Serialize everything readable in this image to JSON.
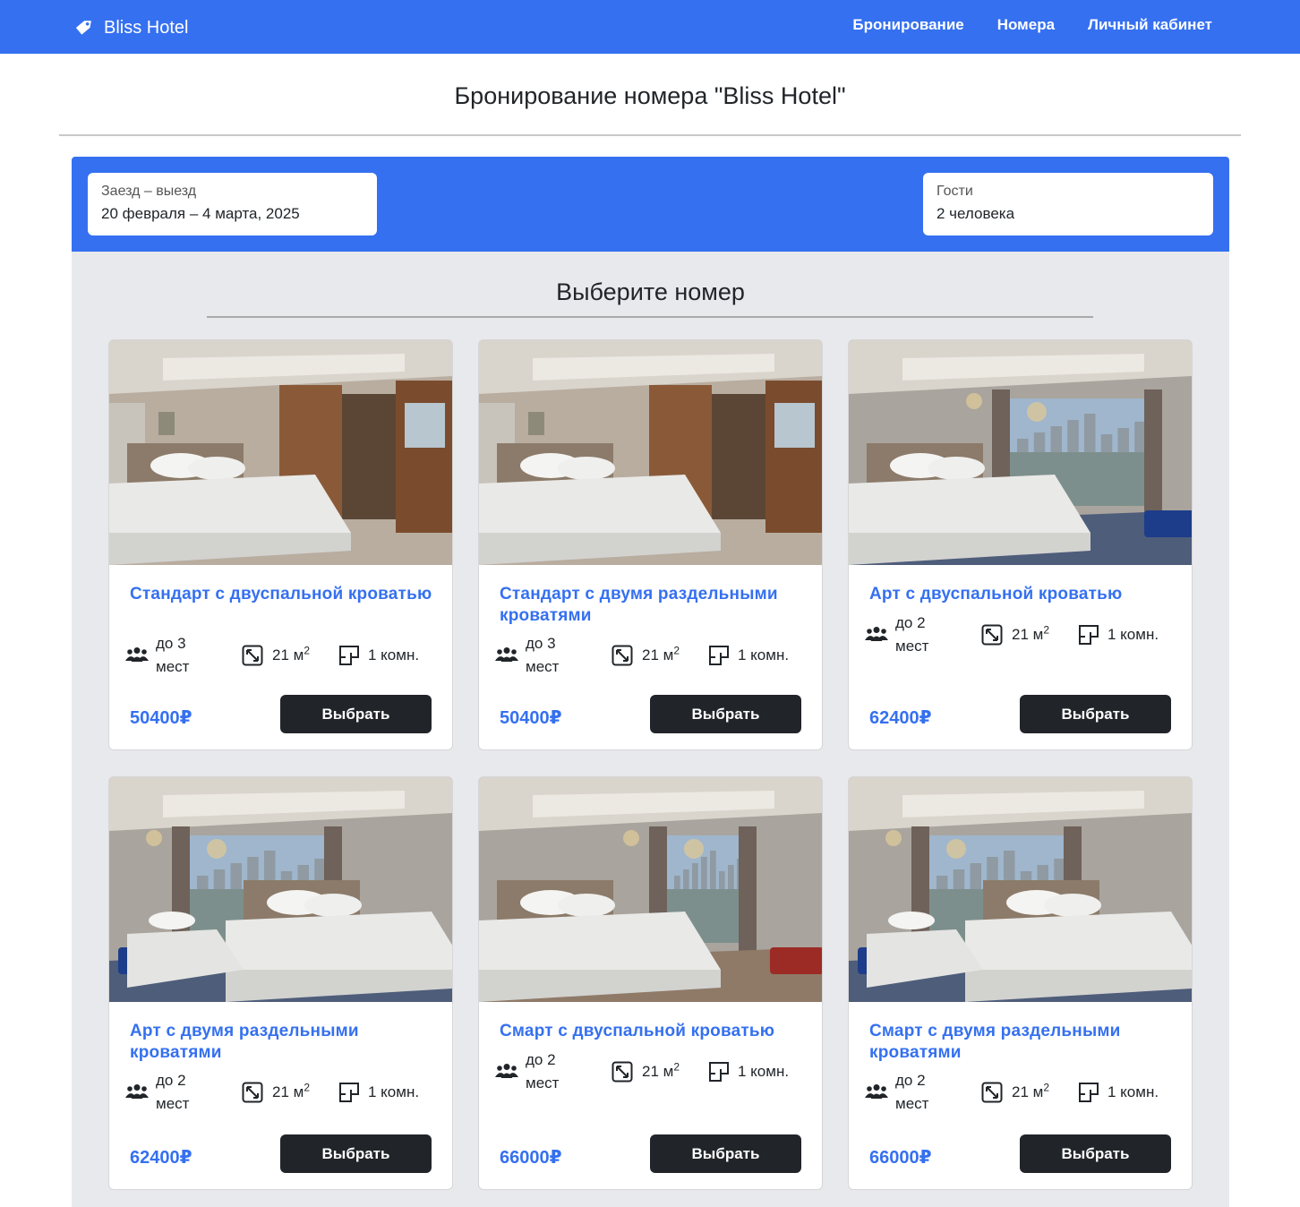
{
  "nav": {
    "brand": "Bliss Hotel",
    "links": [
      "Бронирование",
      "Номера",
      "Личный кабинет"
    ]
  },
  "page_title": "Бронирование номера \"Bliss Hotel\"",
  "search": {
    "dates_label": "Заезд – выезд",
    "dates_value": "20 февраля – 4 марта, 2025",
    "guests_label": "Гости",
    "guests_value": "2 человека"
  },
  "section_title": "Выберите номер",
  "colors": {
    "accent": "#3570f0",
    "button": "#212529",
    "panel": "#e8e9ec"
  },
  "rooms": [
    {
      "title": "Стандарт с двуспальной кроватью",
      "capacity": "до 3 мест",
      "area": "21 м",
      "area_sup": "2",
      "rooms": "1 комн.",
      "price": "50400₽",
      "button": "Выбрать"
    },
    {
      "title": "Стандарт с двумя раздельными кроватями",
      "capacity": "до 3 мест",
      "area": "21 м",
      "area_sup": "2",
      "rooms": "1 комн.",
      "price": "50400₽",
      "button": "Выбрать"
    },
    {
      "title": "Арт с двуспальной кроватью",
      "capacity": "до 2 мест",
      "area": "21 м",
      "area_sup": "2",
      "rooms": "1 комн.",
      "price": "62400₽",
      "button": "Выбрать"
    },
    {
      "title": "Арт с двумя раздельными кроватями",
      "capacity": "до 2 мест",
      "area": "21 м",
      "area_sup": "2",
      "rooms": "1 комн.",
      "price": "62400₽",
      "button": "Выбрать"
    },
    {
      "title": "Смарт с двуспальной кроватью",
      "capacity": "до 2 мест",
      "area": "21 м",
      "area_sup": "2",
      "rooms": "1 комн.",
      "price": "66000₽",
      "button": "Выбрать"
    },
    {
      "title": "Смарт с двумя раздельными кроватями",
      "capacity": "до 2 мест",
      "area": "21 м",
      "area_sup": "2",
      "rooms": "1 комн.",
      "price": "66000₽",
      "button": "Выбрать"
    }
  ]
}
